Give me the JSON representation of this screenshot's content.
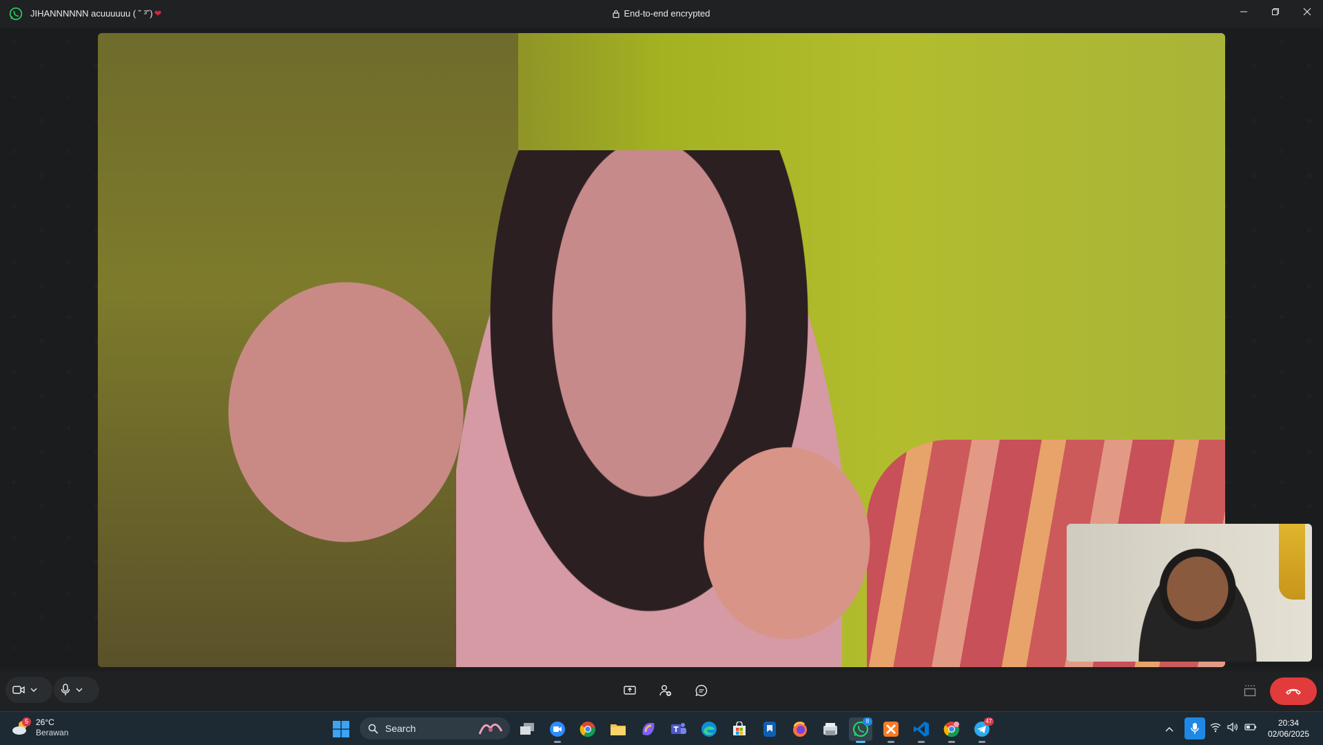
{
  "titlebar": {
    "contact_name": "JIHANNNNNN acuuuuuu ( ˘ ³˘)",
    "heart": "❤",
    "encryption_label": "End-to-end encrypted"
  },
  "taskbar": {
    "weather": {
      "temperature": "26°C",
      "condition": "Berawan",
      "badge": "5"
    },
    "search_label": "Search",
    "apps": [
      {
        "name": "task-view",
        "badge": ""
      },
      {
        "name": "zoom",
        "badge": ""
      },
      {
        "name": "chrome",
        "badge": ""
      },
      {
        "name": "file-explorer",
        "badge": ""
      },
      {
        "name": "copilot",
        "badge": ""
      },
      {
        "name": "teams",
        "badge": ""
      },
      {
        "name": "edge",
        "badge": ""
      },
      {
        "name": "microsoft-store",
        "badge": ""
      },
      {
        "name": "figma-like",
        "badge": ""
      },
      {
        "name": "firefox",
        "badge": ""
      },
      {
        "name": "folder-app",
        "badge": ""
      },
      {
        "name": "whatsapp",
        "badge": "8"
      },
      {
        "name": "xampp",
        "badge": ""
      },
      {
        "name": "vscode",
        "badge": ""
      },
      {
        "name": "chrome-profile",
        "badge": ""
      },
      {
        "name": "telegram",
        "badge": "47"
      }
    ],
    "clock": {
      "time": "20:34",
      "date": "02/06/2025"
    }
  },
  "colors": {
    "end_call": "#e23b3b",
    "whatsapp_green": "#25d366",
    "mic_active": "#1e88e5"
  }
}
